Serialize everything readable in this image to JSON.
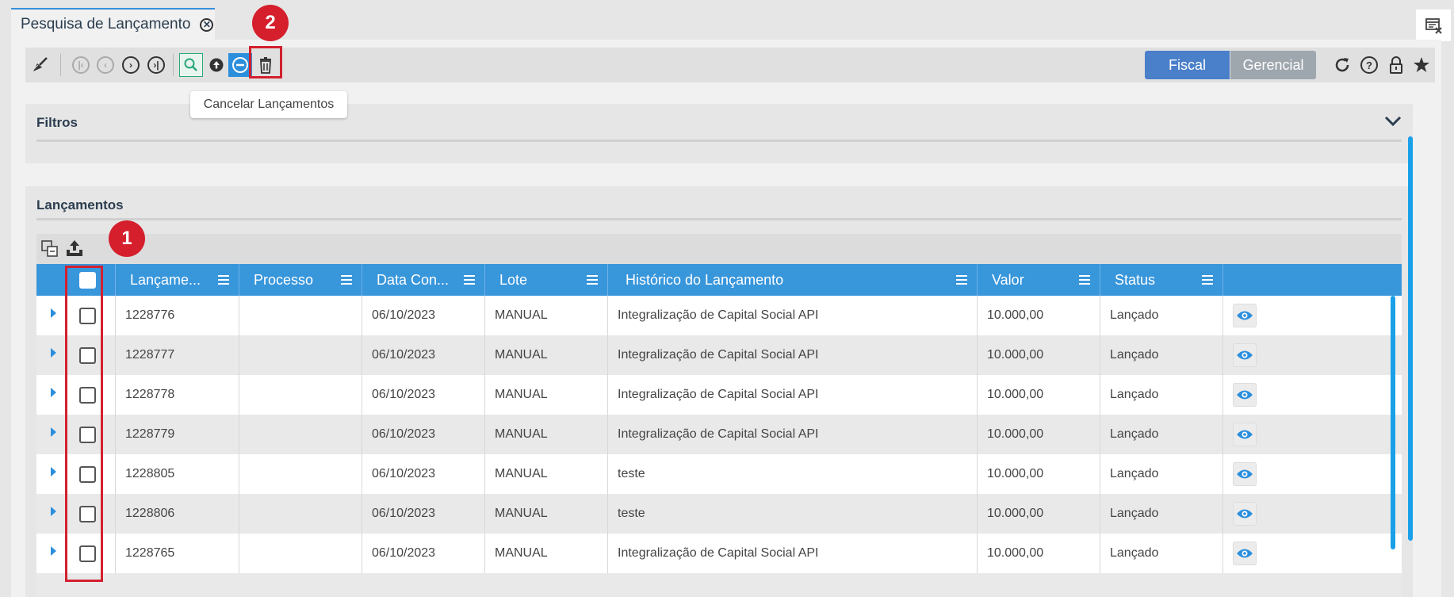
{
  "tab": {
    "title": "Pesquisa de Lançamento"
  },
  "toolbar": {
    "fiscal_label": "Fiscal",
    "gerencial_label": "Gerencial",
    "tooltip": "Cancelar Lançamentos"
  },
  "filtros": {
    "title": "Filtros"
  },
  "lancamentos": {
    "title": "Lançamentos",
    "columns": [
      "Lançame...",
      "Processo",
      "Data Con...",
      "Lote",
      "Histórico do Lançamento",
      "Valor",
      "Status"
    ],
    "rows": [
      {
        "id": "1228776",
        "processo": "",
        "data": "06/10/2023",
        "lote": "MANUAL",
        "historico": "Integralização de Capital Social API",
        "valor": "10.000,00",
        "status": "Lançado"
      },
      {
        "id": "1228777",
        "processo": "",
        "data": "06/10/2023",
        "lote": "MANUAL",
        "historico": "Integralização de Capital Social API",
        "valor": "10.000,00",
        "status": "Lançado"
      },
      {
        "id": "1228778",
        "processo": "",
        "data": "06/10/2023",
        "lote": "MANUAL",
        "historico": "Integralização de Capital Social API",
        "valor": "10.000,00",
        "status": "Lançado"
      },
      {
        "id": "1228779",
        "processo": "",
        "data": "06/10/2023",
        "lote": "MANUAL",
        "historico": "Integralização de Capital Social API",
        "valor": "10.000,00",
        "status": "Lançado"
      },
      {
        "id": "1228805",
        "processo": "",
        "data": "06/10/2023",
        "lote": "MANUAL",
        "historico": "teste",
        "valor": "10.000,00",
        "status": "Lançado"
      },
      {
        "id": "1228806",
        "processo": "",
        "data": "06/10/2023",
        "lote": "MANUAL",
        "historico": "teste",
        "valor": "10.000,00",
        "status": "Lançado"
      },
      {
        "id": "1228765",
        "processo": "",
        "data": "06/10/2023",
        "lote": "MANUAL",
        "historico": "Integralização de Capital Social API",
        "valor": "10.000,00",
        "status": "Lançado"
      }
    ]
  },
  "annotations": {
    "badge1": "1",
    "badge2": "2"
  },
  "colors": {
    "header_blue": "#3896db",
    "accent_red": "#d51f2d",
    "toggle_active": "#4a7fc9"
  }
}
